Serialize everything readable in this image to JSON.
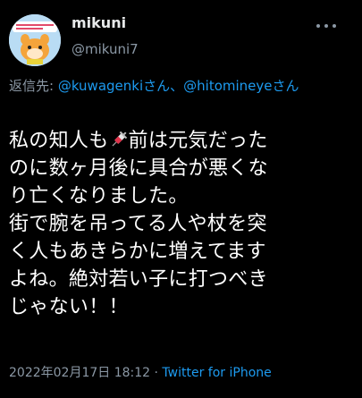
{
  "tweet": {
    "display_name": "mikuni",
    "handle": "@mikuni7",
    "reply_prefix": "返信先: ",
    "mention_1": "@kuwagenkiさん",
    "mention_sep": "、",
    "mention_2": "@hitomineyeさん",
    "body_line_1a": "私の知人も",
    "body_line_1b": "前は元気だった",
    "body_line_2": "のに数ヶ月後に具合が悪くな",
    "body_line_3": "り亡くなりました。",
    "body_line_4": "街で腕を吊ってる人や杖を突",
    "body_line_5": "く人もあきらかに増えてます",
    "body_line_6": "よね。絶対若い子に打つべき",
    "body_line_7": "じゃない！！",
    "timestamp": "2022年02月17日 18:12",
    "separator": " · ",
    "source": "Twitter for iPhone",
    "icons": {
      "avatar": "mascot-avatar",
      "more": "more-options-icon",
      "syringe": "syringe-emoji"
    },
    "colors": {
      "background": "#000000",
      "text": "#ffffff",
      "secondary": "#8b98a5",
      "link": "#1d9bf0"
    }
  }
}
